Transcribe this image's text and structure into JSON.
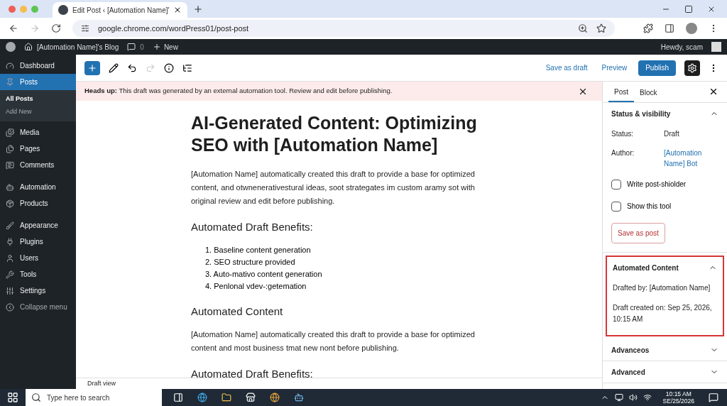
{
  "browser": {
    "tab_title": "Edit Post ‹ [Automation Name]'",
    "url": "google.chrome.com/wordPress01/post-post"
  },
  "admin_bar": {
    "site": "[Automation Name]'s Blog",
    "comments": "0",
    "new": "New",
    "greeting": "Hewdy, scam"
  },
  "menu": [
    {
      "label": "Dashboard",
      "selected": false
    },
    {
      "label": "Posts",
      "selected": true,
      "submenu": [
        {
          "label": "All Posts",
          "selected": true
        },
        {
          "label": "Add New",
          "selected": false
        }
      ]
    },
    {
      "label": "Media",
      "selected": false
    },
    {
      "label": "Pages",
      "selected": false
    },
    {
      "label": "Comments",
      "selected": false
    },
    {
      "label": "Automation",
      "selected": false
    },
    {
      "label": "Products",
      "selected": false
    },
    {
      "label": "Appearance",
      "selected": false
    },
    {
      "label": "Plugins",
      "selected": false
    },
    {
      "label": "Users",
      "selected": false
    },
    {
      "label": "Tools",
      "selected": false
    },
    {
      "label": "Settings",
      "selected": false
    },
    {
      "label": "Collapse menu",
      "selected": false
    }
  ],
  "toolbar": {
    "save_draft": "Save as draft",
    "preview": "Preview",
    "publish": "Publish"
  },
  "notice": "**Heads up:** This draft was generated by an external automation tool. Review and edit before publishing.",
  "post": {
    "title": "AI-Generated Content: Optimizing SEO with [Automation Name]",
    "blocks": [
      {
        "kind": "paragraph",
        "text": "[Automation Name] automatically created this draft to provide a base for optimized content, and otwnenerativestural ideas, soot strategates im custom aramy sot with original review and edit before publishing."
      },
      {
        "kind": "heading",
        "text": "Automated Draft Benefits:"
      },
      {
        "kind": "list",
        "items": [
          "1. Baseline content generation",
          "2. SEO structure provided",
          "3. Auto-mativo content generation",
          "4. Penlonal vdev-:getemation"
        ]
      },
      {
        "kind": "heading",
        "text": "Automated Content"
      },
      {
        "kind": "paragraph",
        "text": "[Automation Name] automatically created this draft to provide a base for optimized content and most business tmat new nont before publishing."
      },
      {
        "kind": "heading",
        "text": "Automated Draft Benefits:"
      }
    ]
  },
  "footer": "Draft view",
  "settings": {
    "tabs": [
      {
        "label": "Post",
        "selected": true
      },
      {
        "label": "Block",
        "selected": false
      }
    ],
    "sections": [
      {
        "title": "Status & visibility",
        "expanded": true,
        "highlighted": false,
        "rows": [
          {
            "kind": "field",
            "label": "Status:",
            "value": "Draft"
          },
          {
            "kind": "link",
            "label": "Author:",
            "value": "[Automation Name] Bot"
          },
          {
            "kind": "checkbox",
            "label": "Write post-shiolder",
            "checked": false
          },
          {
            "kind": "checkbox",
            "label": "Show this tool",
            "checked": false
          },
          {
            "kind": "button",
            "label": "Save as post"
          }
        ]
      },
      {
        "title": "Automated Content",
        "expanded": true,
        "highlighted": true,
        "rows": [
          {
            "kind": "text",
            "label": "Drafted by: [Automation Name]"
          },
          {
            "kind": "text",
            "label": "Draft created on: Sep 25, 2026, 10:15 AM"
          }
        ]
      },
      {
        "title": "Advanceos",
        "expanded": false,
        "highlighted": false
      },
      {
        "title": "Advanced",
        "expanded": false,
        "highlighted": false
      }
    ]
  },
  "taskbar": {
    "search_placeholder": "Type here to search",
    "time": "10:15 AM",
    "date": "SE/25/2026"
  }
}
